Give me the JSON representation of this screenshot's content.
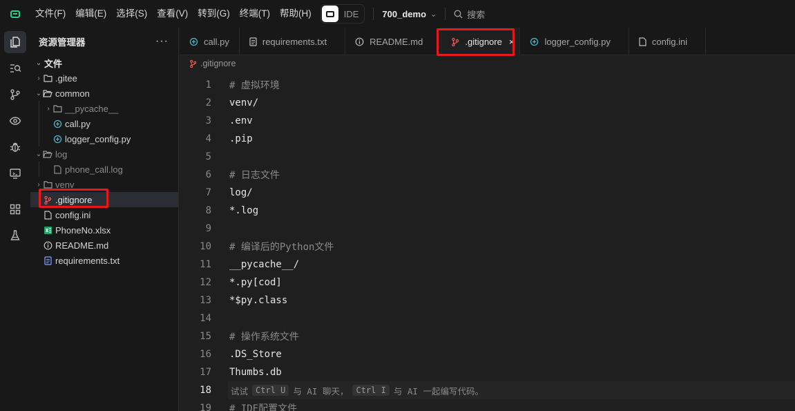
{
  "titlebar": {
    "menu": [
      "文件(F)",
      "编辑(E)",
      "选择(S)",
      "查看(V)",
      "转到(G)",
      "终端(T)",
      "帮助(H)"
    ],
    "ide_label": "IDE",
    "project": "700_demo",
    "search_label": "搜索"
  },
  "sidebar": {
    "title": "资源管理器",
    "more": "···",
    "root": "文件",
    "items": [
      {
        "label": ".gitee"
      },
      {
        "label": "common"
      },
      {
        "label": "__pycache__"
      },
      {
        "label": "call.py"
      },
      {
        "label": "logger_config.py"
      },
      {
        "label": "log"
      },
      {
        "label": "phone_call.log"
      },
      {
        "label": "venv"
      },
      {
        "label": ".gitignore"
      },
      {
        "label": "config.ini"
      },
      {
        "label": "PhoneNo.xlsx"
      },
      {
        "label": "README.md"
      },
      {
        "label": "requirements.txt"
      }
    ]
  },
  "tabs": [
    {
      "label": "call.py"
    },
    {
      "label": "requirements.txt"
    },
    {
      "label": "README.md"
    },
    {
      "label": ".gitignore",
      "close": "×"
    },
    {
      "label": "logger_config.py"
    },
    {
      "label": "config.ini"
    }
  ],
  "breadcrumb": ".gitignore",
  "editor": {
    "current_line": 18,
    "lines": [
      {
        "n": "1",
        "text": "# 虚拟环境"
      },
      {
        "n": "2",
        "text": "venv/"
      },
      {
        "n": "3",
        "text": ".env"
      },
      {
        "n": "4",
        "text": ".pip"
      },
      {
        "n": "5",
        "text": ""
      },
      {
        "n": "6",
        "text": "# 日志文件"
      },
      {
        "n": "7",
        "text": "log/"
      },
      {
        "n": "8",
        "text": "*.log"
      },
      {
        "n": "9",
        "text": ""
      },
      {
        "n": "10",
        "text": "# 编译后的Python文件"
      },
      {
        "n": "11",
        "text": "__pycache__/"
      },
      {
        "n": "12",
        "text": "*.py[cod]"
      },
      {
        "n": "13",
        "text": "*$py.class"
      },
      {
        "n": "14",
        "text": ""
      },
      {
        "n": "15",
        "text": "# 操作系统文件"
      },
      {
        "n": "16",
        "text": ".DS_Store"
      },
      {
        "n": "17",
        "text": "Thumbs.db"
      },
      {
        "n": "18",
        "text": ""
      },
      {
        "n": "19",
        "text": "# IDE配置文件"
      }
    ],
    "hint": {
      "try": "试试",
      "key1": "Ctrl U",
      "mid1": "与 AI 聊天，",
      "key2": "Ctrl I",
      "mid2": "与 AI 一起编写代码。"
    }
  },
  "colors": {
    "accent_green": "#23d18b",
    "highlight_red": "#e3191b",
    "git_icon": "#f05a5a",
    "python_icon": "#4fb6c9",
    "excel_icon": "#21a366"
  }
}
